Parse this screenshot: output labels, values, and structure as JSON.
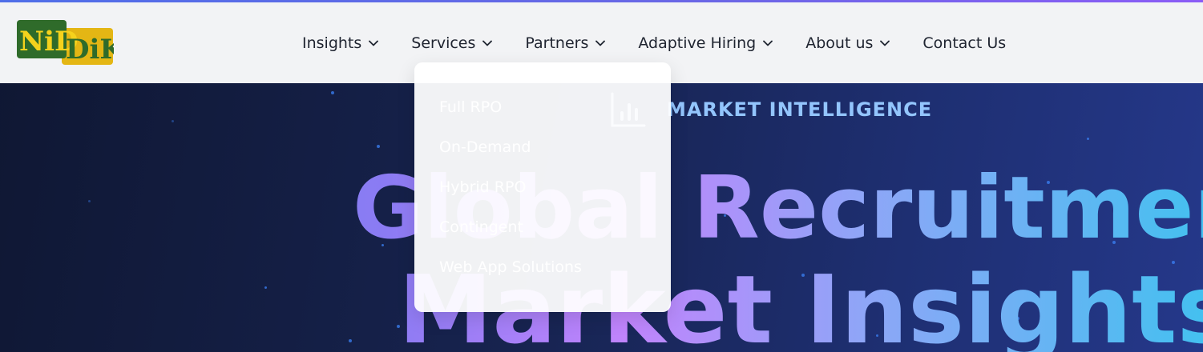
{
  "header": {
    "logo_alt": "NIDDIK",
    "nav": [
      {
        "label": "Insights",
        "has_dropdown": true
      },
      {
        "label": "Services",
        "has_dropdown": true
      },
      {
        "label": "Partners",
        "has_dropdown": true
      },
      {
        "label": "Adaptive Hiring",
        "has_dropdown": true
      },
      {
        "label": "About us",
        "has_dropdown": true
      },
      {
        "label": "Contact Us",
        "has_dropdown": false
      }
    ]
  },
  "services_dropdown": {
    "items": [
      "Full RPO",
      "On-Demand",
      "Hybrid RPO",
      "Contingent",
      "Web App Solutions"
    ]
  },
  "hero": {
    "eyebrow": "MARKET INTELLIGENCE",
    "eyebrow_icon": "bar-chart-icon",
    "title_line1": "Global Recruitment",
    "title_line2": "Market Insights"
  },
  "colors": {
    "accent_line": "#6b66e6",
    "eyebrow": "#93c5fd",
    "title_gradient": [
      "#6b8cf6",
      "#c084fc",
      "#44c0f0"
    ],
    "logo_green": "#2f6b2a",
    "logo_yellow": "#e4b614"
  }
}
